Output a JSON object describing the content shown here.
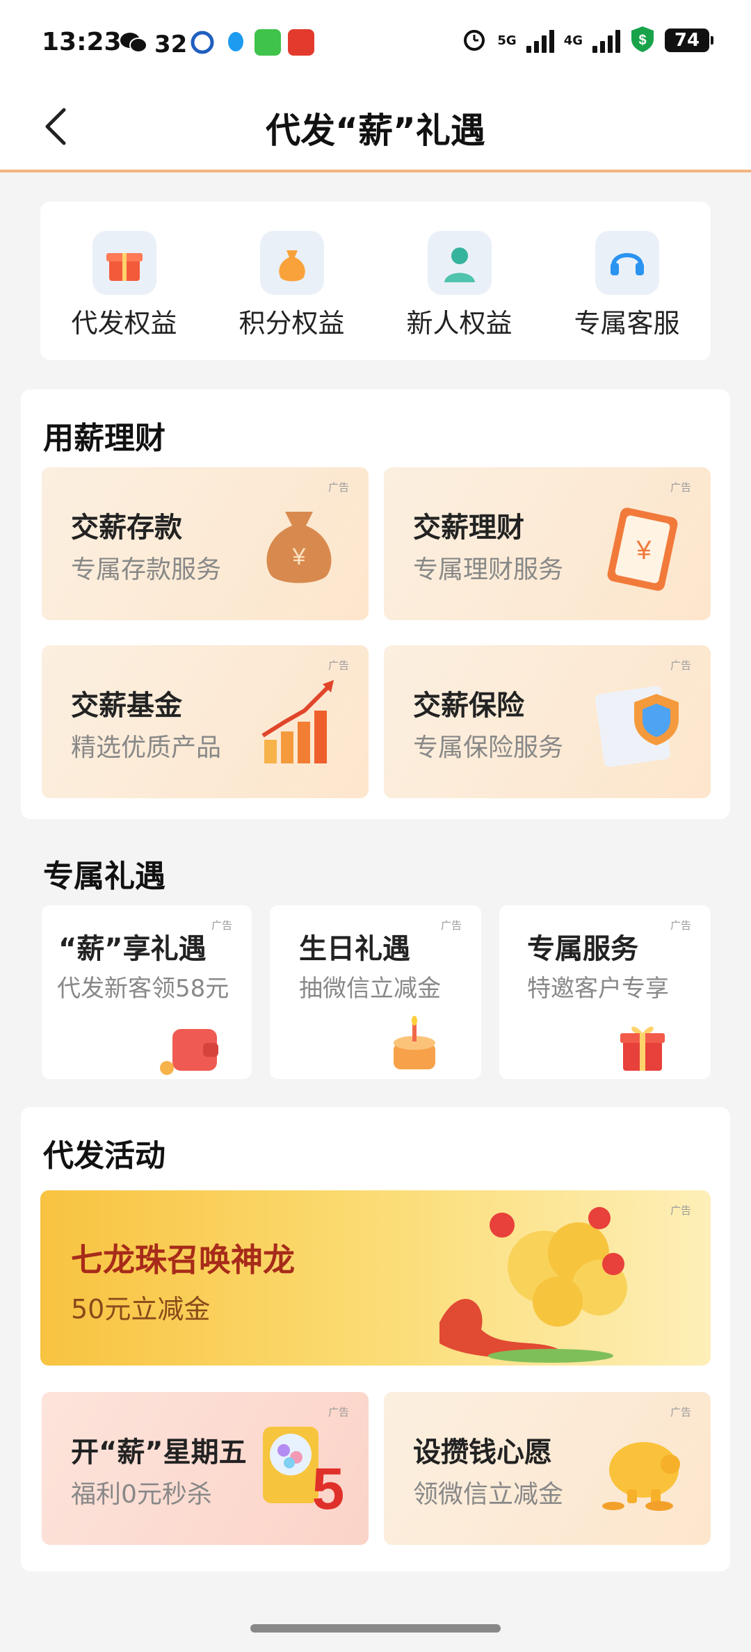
{
  "status_bar": {
    "time": "13:23",
    "notification_count": "32",
    "network_1": "5G",
    "network_2": "4G",
    "battery": "74"
  },
  "nav": {
    "title": "代发“薪”礼遇"
  },
  "quick_actions": [
    {
      "label": "代发权益",
      "icon": "gift-icon"
    },
    {
      "label": "积分权益",
      "icon": "money-bag-icon"
    },
    {
      "label": "新人权益",
      "icon": "person-icon"
    },
    {
      "label": "专属客服",
      "icon": "headset-icon"
    }
  ],
  "wealth_section": {
    "title": "用薪理财",
    "tiles": [
      {
        "title": "交薪存款",
        "subtitle": "专属存款服务",
        "ad": "广告",
        "icon": "money-bag-icon"
      },
      {
        "title": "交薪理财",
        "subtitle": "专属理财服务",
        "ad": "广告",
        "icon": "clipboard-yen-icon"
      },
      {
        "title": "交薪基金",
        "subtitle": "精选优质产品",
        "ad": "广告",
        "icon": "growth-chart-icon"
      },
      {
        "title": "交薪保险",
        "subtitle": "专属保险服务",
        "ad": "广告",
        "icon": "shield-document-icon"
      }
    ]
  },
  "gift_section": {
    "title": "专属礼遇",
    "cards": [
      {
        "title": "“薪”享礼遇",
        "subtitle": "代发新客领58元",
        "ad": "广告",
        "icon": "wallet-icon"
      },
      {
        "title": "生日礼遇",
        "subtitle": "抽微信立减金",
        "ad": "广告",
        "icon": "cake-icon"
      },
      {
        "title": "专属服务",
        "subtitle": "特邀客户专享",
        "ad": "广告",
        "icon": "gift-box-icon"
      }
    ]
  },
  "activity_section": {
    "title": "代发活动",
    "banner": {
      "title": "七龙珠召唤神龙",
      "subtitle": "50元立减金",
      "ad": "广告",
      "icon": "dragon-icon"
    },
    "tiles": [
      {
        "title": "开“薪”星期五",
        "subtitle": "福利0元秒杀",
        "ad": "广告",
        "icon": "gacha-machine-icon"
      },
      {
        "title": "设攒钱心愿",
        "subtitle": "领微信立减金",
        "ad": "广告",
        "icon": "piggy-bank-icon"
      }
    ]
  },
  "colors": {
    "accent_orange": "#f3b47d",
    "banner_red_text": "#a72b1a"
  }
}
